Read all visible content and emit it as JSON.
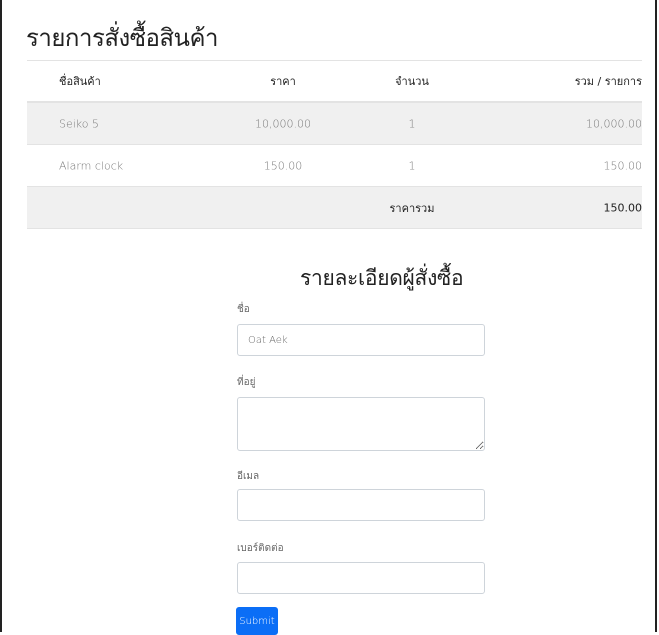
{
  "page": {
    "title": "รายการสั่งซื้อสินค้า"
  },
  "table": {
    "headers": {
      "name": "ชื่อสินค้า",
      "price": "ราคา",
      "qty": "จำนวน",
      "total": "รวม / รายการ"
    },
    "rows": [
      {
        "name": "Seiko 5",
        "price": "10,000.00",
        "qty": "1",
        "total": "10,000.00"
      },
      {
        "name": "Alarm clock",
        "price": "150.00",
        "qty": "1",
        "total": "150.00"
      }
    ],
    "summary": {
      "label": "ราคารวม",
      "value": "150.00"
    }
  },
  "form": {
    "title": "รายละเอียดผู้สั่งซื้อ",
    "name_label": "ชื่อ",
    "name_value": "Oat Aek",
    "address_label": "ที่อยู่",
    "address_value": "",
    "email_label": "อีเมล",
    "email_value": "",
    "phone_label": "เบอร์ติดต่อ",
    "phone_value": "",
    "submit_label": "Submit"
  },
  "colors": {
    "accent": "#0b6ef6",
    "stripe": "#f0f0f0"
  }
}
